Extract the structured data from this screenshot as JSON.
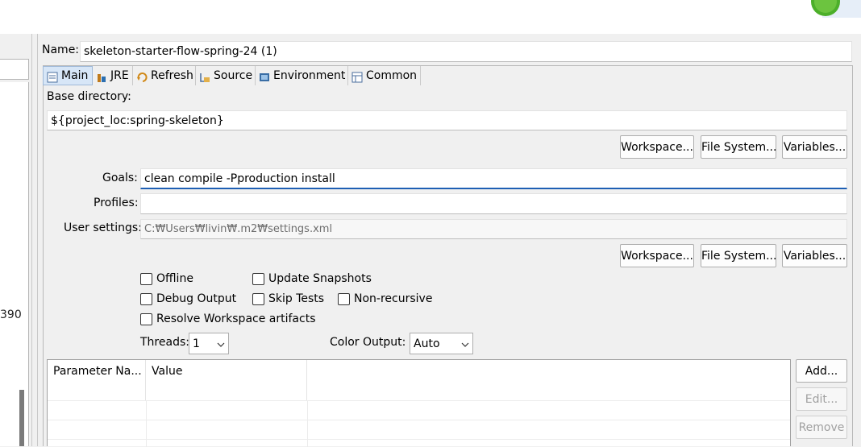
{
  "name_field": {
    "label": "Name:",
    "value": "skeleton-starter-flow-spring-24 (1)"
  },
  "tabs": [
    {
      "label": "Main",
      "icon": "main-tab-icon",
      "active": true
    },
    {
      "label": "JRE",
      "icon": "jre-icon",
      "active": false
    },
    {
      "label": "Refresh",
      "icon": "refresh-icon",
      "active": false
    },
    {
      "label": "Source",
      "icon": "source-icon",
      "active": false
    },
    {
      "label": "Environment",
      "icon": "environment-icon",
      "active": false
    },
    {
      "label": "Common",
      "icon": "common-icon",
      "active": false
    }
  ],
  "base_directory": {
    "label": "Base directory:",
    "value": "${project_loc:spring-skeleton}"
  },
  "base_buttons": {
    "workspace": "Workspace...",
    "file_system": "File System...",
    "variables": "Variables..."
  },
  "goals": {
    "label": "Goals:",
    "value": "clean compile -Pproduction install"
  },
  "profiles": {
    "label": "Profiles:",
    "value": ""
  },
  "user_settings": {
    "label": "User settings:",
    "value": "C:₩Users₩livin₩.m2₩settings.xml"
  },
  "settings_buttons": {
    "workspace": "Workspace...",
    "file_system": "File System...",
    "variables": "Variables..."
  },
  "options": {
    "offline": "Offline",
    "update_snapshots": "Update Snapshots",
    "debug_output": "Debug Output",
    "skip_tests": "Skip Tests",
    "non_recursive": "Non-recursive",
    "resolve_workspace": "Resolve Workspace artifacts"
  },
  "threads": {
    "label": "Threads:",
    "value": "1"
  },
  "color_output": {
    "label": "Color Output:",
    "value": "Auto"
  },
  "parameters_table": {
    "columns": [
      "Parameter Na...",
      "Value"
    ],
    "rows": []
  },
  "table_buttons": {
    "add": "Add...",
    "edit": "Edit...",
    "remove": "Remove"
  },
  "left_panel": {
    "partial_text": "390"
  },
  "colors": {
    "focus_accent": "#1e5fb4",
    "active_tab_bg": "#d7e6f7",
    "run_icon_green": "#4caf2a"
  }
}
